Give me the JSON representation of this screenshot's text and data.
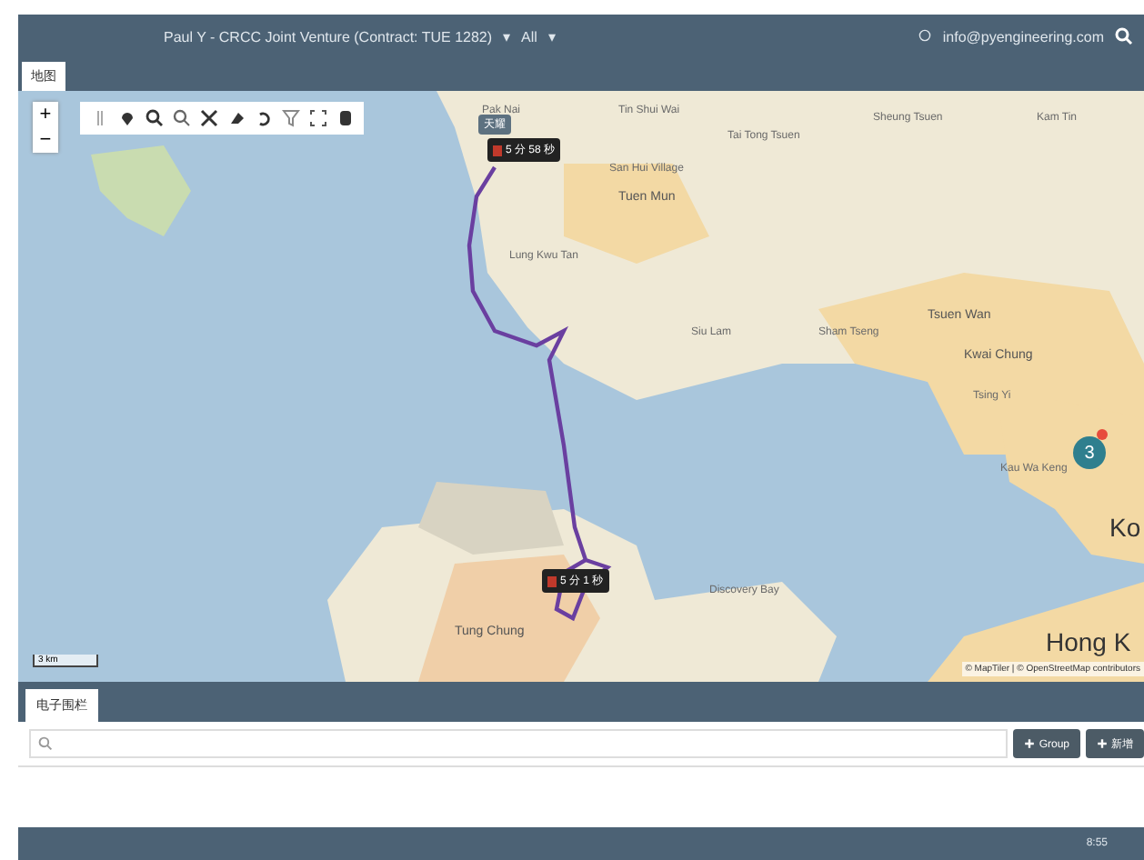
{
  "header": {
    "project": "Paul Y - CRCC Joint Venture (Contract: TUE 1282)",
    "project_caret": "▾",
    "filter": "All",
    "filter_caret": "▾",
    "user": "info@pyengineering.com"
  },
  "tabs": [
    {
      "label": "地图",
      "selected": true
    }
  ],
  "map": {
    "zoom_in": "+",
    "zoom_out": "−",
    "labels": [
      {
        "text": "Pak Nai",
        "kind": "place"
      },
      {
        "text": "Tin Shui Wai",
        "kind": "place"
      },
      {
        "text": "Tai Tong Tsuen",
        "kind": "place"
      },
      {
        "text": "Sheung Tsuen",
        "kind": "place"
      },
      {
        "text": "Kam Tin",
        "kind": "place"
      },
      {
        "text": "San Hui Village",
        "kind": "place"
      },
      {
        "text": "Tuen Mun",
        "kind": "town"
      },
      {
        "text": "Lung Kwu Tan",
        "kind": "place"
      },
      {
        "text": "Siu Lam",
        "kind": "place"
      },
      {
        "text": "Sham Tseng",
        "kind": "place"
      },
      {
        "text": "Tsuen Wan",
        "kind": "town"
      },
      {
        "text": "Kwai Chung",
        "kind": "town"
      },
      {
        "text": "Tsing Yi",
        "kind": "place"
      },
      {
        "text": "Kau Wa Keng",
        "kind": "place"
      },
      {
        "text": "Discovery Bay",
        "kind": "place"
      },
      {
        "text": "Tung Chung",
        "kind": "town"
      },
      {
        "text": "Ko",
        "kind": "city"
      },
      {
        "text": "Hong K",
        "kind": "city"
      }
    ],
    "markers": [
      {
        "tag": "天耀",
        "time": "5 分 58 秒"
      },
      {
        "time": "5 分 1 秒"
      }
    ],
    "cluster": {
      "count": "3"
    },
    "scale": "3 km",
    "attribution": "© MapTiler | © OpenStreetMap contributors"
  },
  "panel": {
    "tab": "电子围栏",
    "buttons": [
      {
        "label": "Group"
      },
      {
        "label": "新增"
      }
    ]
  },
  "status_bar": {
    "time": "8:55"
  }
}
